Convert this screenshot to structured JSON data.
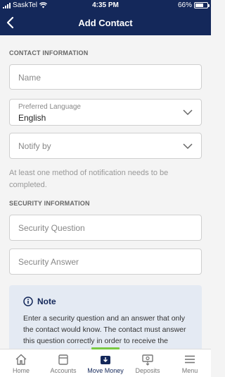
{
  "status": {
    "carrier": "SaskTel",
    "time": "4:35 PM",
    "battery": "66%",
    "battery_level": 0.66
  },
  "header": {
    "title": "Add Contact"
  },
  "contact_section": {
    "header": "CONTACT INFORMATION",
    "name_placeholder": "Name",
    "language_label": "Preferred Language",
    "language_value": "English",
    "notify_placeholder": "Notify by",
    "helper": "At least one method of notification needs to be completed."
  },
  "security_section": {
    "header": "SECURITY INFORMATION",
    "question_placeholder": "Security Question",
    "answer_placeholder": "Security Answer"
  },
  "note": {
    "title": "Note",
    "text": "Enter a security question and an answer that only the contact would know. The contact must answer this question correctly in order to receive the money. Do not share the answer by email."
  },
  "tabs": [
    {
      "label": "Home",
      "icon": "home-icon"
    },
    {
      "label": "Accounts",
      "icon": "accounts-icon"
    },
    {
      "label": "Move Money",
      "icon": "move-money-icon"
    },
    {
      "label": "Deposits",
      "icon": "deposits-icon"
    },
    {
      "label": "Menu",
      "icon": "menu-icon"
    }
  ],
  "colors": {
    "brand": "#14285a",
    "accent": "#7ac943"
  }
}
